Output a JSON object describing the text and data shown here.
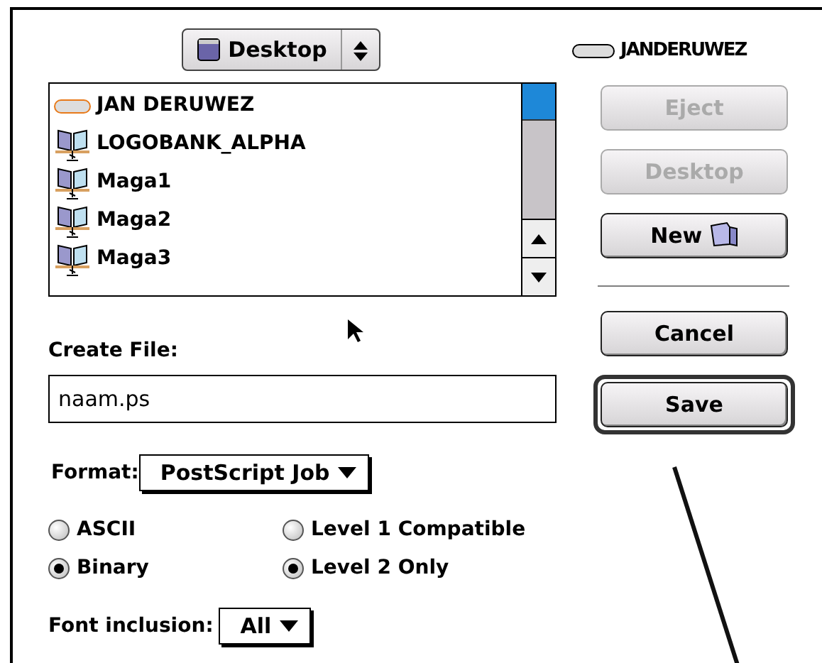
{
  "location_popup": {
    "label": "Desktop"
  },
  "volume": {
    "label": "JANDERUWEZ"
  },
  "file_list": {
    "items": [
      {
        "name": "JAN DERUWEZ",
        "kind": "drive"
      },
      {
        "name": "LOGOBANK_ALPHA",
        "kind": "shared"
      },
      {
        "name": "Maga1",
        "kind": "shared"
      },
      {
        "name": "Maga2",
        "kind": "shared"
      },
      {
        "name": "Maga3",
        "kind": "shared"
      }
    ]
  },
  "top_buttons": [
    {
      "label": "Eject",
      "disabled": true,
      "kind": "text"
    },
    {
      "label": "Desktop",
      "disabled": true,
      "kind": "text"
    },
    {
      "label": "New",
      "disabled": false,
      "kind": "folder"
    }
  ],
  "bottom_buttons": [
    {
      "label": "Cancel",
      "default": false
    },
    {
      "label": "Save",
      "default": true
    }
  ],
  "create_file": {
    "label": "Create File:",
    "value": "naam.ps"
  },
  "format": {
    "label": "Format:",
    "value": "PostScript Job"
  },
  "encoding_options": [
    {
      "label": "ASCII",
      "selected": false
    },
    {
      "label": "Binary",
      "selected": true
    }
  ],
  "level_options": [
    {
      "label": "Level 1 Compatible",
      "selected": false
    },
    {
      "label": "Level 2 Only",
      "selected": true
    }
  ],
  "font_inclusion": {
    "label": "Font inclusion:",
    "value": "All"
  }
}
